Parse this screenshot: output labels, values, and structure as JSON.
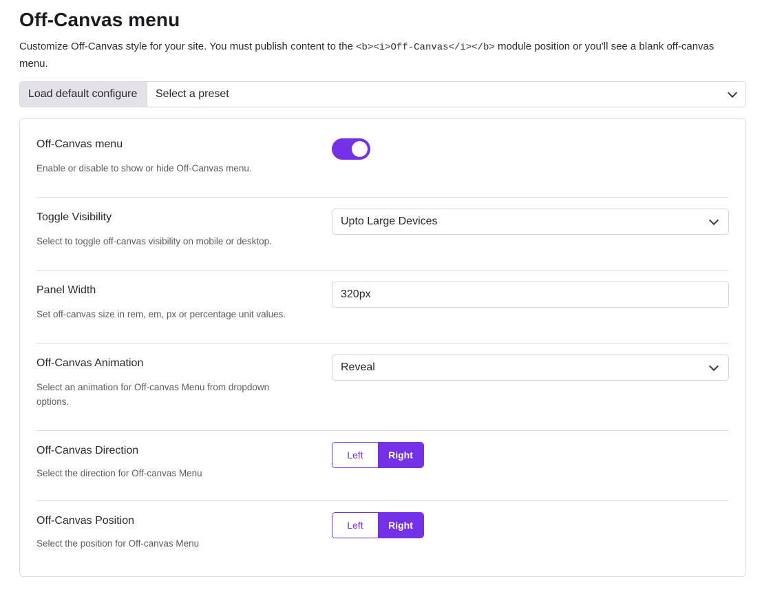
{
  "header": {
    "title": "Off-Canvas menu",
    "description_before": "Customize Off-Canvas style for your site. You must publish content to the ",
    "description_code": "<b><i>Off-Canvas</i></b>",
    "description_after": " module position or you'll see a blank off-canvas menu."
  },
  "preset": {
    "label": "Load default configure",
    "selected": "Select a preset"
  },
  "settings": {
    "offcanvas_menu": {
      "title": "Off-Canvas menu",
      "description": "Enable or disable to show or hide Off-Canvas menu.",
      "enabled": true
    },
    "toggle_visibility": {
      "title": "Toggle Visibility",
      "description": "Select to toggle off-canvas visibility on mobile or desktop.",
      "selected": "Upto Large Devices"
    },
    "panel_width": {
      "title": "Panel Width",
      "description": "Set off-canvas size in rem, em, px or percentage unit values.",
      "value": "320px"
    },
    "animation": {
      "title": "Off-Canvas Animation",
      "description": "Select an animation for Off-canvas Menu from dropdown options.",
      "selected": "Reveal"
    },
    "direction": {
      "title": "Off-Canvas Direction",
      "description": "Select the direction for Off-canvas Menu",
      "options": [
        "Left",
        "Right"
      ],
      "selected": "Right"
    },
    "position": {
      "title": "Off-Canvas Position",
      "description": "Select the position for Off-canvas Menu",
      "options": [
        "Left",
        "Right"
      ],
      "selected": "Right"
    }
  },
  "colors": {
    "accent": "#7431e8",
    "preset_label_bg": "#e4e1e8",
    "border": "#d5d3db"
  },
  "icons": {
    "dropdown": "chevron-down-icon"
  }
}
